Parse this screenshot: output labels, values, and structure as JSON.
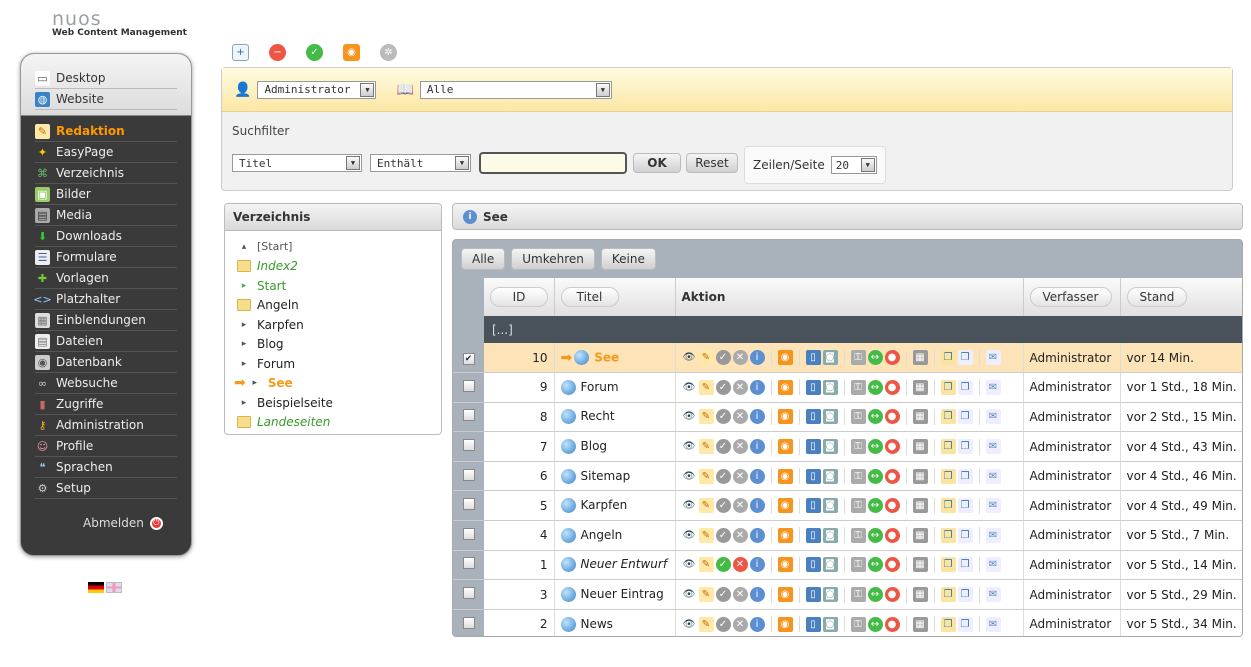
{
  "logo": {
    "name": "nuos",
    "tagline": "Web Content Management"
  },
  "sidebar": {
    "top_items": [
      {
        "label": "Desktop",
        "icon": "desktop-icon"
      },
      {
        "label": "Website",
        "icon": "globe-icon"
      }
    ],
    "items": [
      {
        "label": "Redaktion",
        "icon": "edit-icon",
        "active": true
      },
      {
        "label": "EasyPage",
        "icon": "magic-wand-icon"
      },
      {
        "label": "Verzeichnis",
        "icon": "sitemap-icon"
      },
      {
        "label": "Bilder",
        "icon": "image-icon"
      },
      {
        "label": "Media",
        "icon": "film-icon"
      },
      {
        "label": "Downloads",
        "icon": "download-arrow-icon"
      },
      {
        "label": "Formulare",
        "icon": "form-icon"
      },
      {
        "label": "Vorlagen",
        "icon": "puzzle-icon"
      },
      {
        "label": "Platzhalter",
        "icon": "code-icon"
      },
      {
        "label": "Einblendungen",
        "icon": "box-icon"
      },
      {
        "label": "Dateien",
        "icon": "file-icon"
      },
      {
        "label": "Datenbank",
        "icon": "database-icon"
      },
      {
        "label": "Websuche",
        "icon": "binoculars-icon"
      },
      {
        "label": "Zugriffe",
        "icon": "chart-icon"
      },
      {
        "label": "Administration",
        "icon": "key-icon"
      },
      {
        "label": "Profile",
        "icon": "users-icon"
      },
      {
        "label": "Sprachen",
        "icon": "speech-icon"
      },
      {
        "label": "Setup",
        "icon": "gear-icon"
      }
    ],
    "logout": "Abmelden"
  },
  "filter": {
    "user_select": "Administrator",
    "category_select": "Alle",
    "search_label": "Suchfilter",
    "field_select": "Titel",
    "op_select": "Enthält",
    "search_value": "",
    "ok": "OK",
    "reset": "Reset",
    "rows_label": "Zeilen/Seite",
    "rows_value": "20"
  },
  "directory": {
    "title": "Verzeichnis",
    "items": [
      {
        "label": "[Start]",
        "style": "root"
      },
      {
        "label": "Index2",
        "style": "green"
      },
      {
        "label": "Start",
        "style": "greenplain"
      },
      {
        "label": "Angeln",
        "style": "folder"
      },
      {
        "label": "Karpfen",
        "style": "arrow"
      },
      {
        "label": "Blog",
        "style": "arrow"
      },
      {
        "label": "Forum",
        "style": "arrow"
      },
      {
        "label": "See",
        "style": "active"
      },
      {
        "label": "Beispielseite",
        "style": "arrow"
      },
      {
        "label": "Landeseiten",
        "style": "green"
      }
    ]
  },
  "content": {
    "title": "See",
    "buttons": {
      "all": "Alle",
      "invert": "Umkehren",
      "none": "Keine"
    },
    "columns": {
      "id": "ID",
      "title": "Titel",
      "action": "Aktion",
      "author": "Verfasser",
      "date": "Stand"
    },
    "parent_row": "[...]",
    "rows": [
      {
        "id": "10",
        "title": "See",
        "author": "Administrator",
        "date": "vor 14 Min.",
        "checked": true,
        "highlight": true
      },
      {
        "id": "9",
        "title": "Forum",
        "author": "Administrator",
        "date": "vor 1 Std., 18 Min."
      },
      {
        "id": "8",
        "title": "Recht",
        "author": "Administrator",
        "date": "vor 2 Std., 15 Min."
      },
      {
        "id": "7",
        "title": "Blog",
        "author": "Administrator",
        "date": "vor 4 Std., 43 Min."
      },
      {
        "id": "6",
        "title": "Sitemap",
        "author": "Administrator",
        "date": "vor 4 Std., 46 Min."
      },
      {
        "id": "5",
        "title": "Karpfen",
        "author": "Administrator",
        "date": "vor 4 Std., 49 Min."
      },
      {
        "id": "4",
        "title": "Angeln",
        "author": "Administrator",
        "date": "vor 5 Std., 7 Min."
      },
      {
        "id": "1",
        "title": "Neuer Entwurf",
        "author": "Administrator",
        "date": "vor 5 Std., 14 Min.",
        "italic": true,
        "draft": true
      },
      {
        "id": "3",
        "title": "Neuer Eintrag",
        "author": "Administrator",
        "date": "vor 5 Std., 29 Min."
      },
      {
        "id": "2",
        "title": "News",
        "author": "Administrator",
        "date": "vor 5 Std., 34 Min."
      }
    ]
  }
}
